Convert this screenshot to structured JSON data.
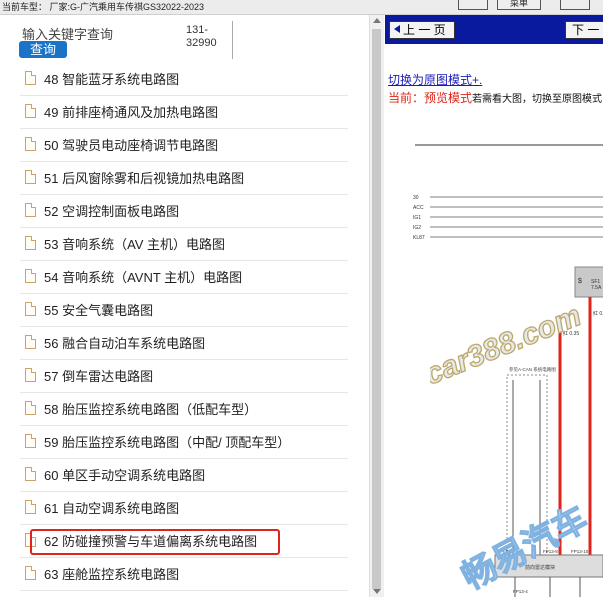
{
  "topbar": {
    "model_text": "当前车型： 厂家:G-广汽乘用车传祺GS32022-2023",
    "button_label": "菜单"
  },
  "search": {
    "label": "输入关键字查询",
    "button": "查询",
    "code_line1": "131-",
    "code_line2": "32990"
  },
  "list": [
    {
      "label": "48 智能蓝牙系统电路图"
    },
    {
      "label": "49 前排座椅通风及加热电路图"
    },
    {
      "label": "50 驾驶员电动座椅调节电路图"
    },
    {
      "label": "51 后风窗除雾和后视镜加热电路图"
    },
    {
      "label": "52 空调控制面板电路图"
    },
    {
      "label": "53 音响系统（AV 主机）电路图"
    },
    {
      "label": "54 音响系统（AVNT 主机）电路图"
    },
    {
      "label": "55 安全气囊电路图"
    },
    {
      "label": "56 融合自动泊车系统电路图"
    },
    {
      "label": "57 倒车雷达电路图"
    },
    {
      "label": "58 胎压监控系统电路图（低配车型）"
    },
    {
      "label": "59 胎压监控系统电路图（中配/ 顶配车型）"
    },
    {
      "label": "60 单区手动空调系统电路图"
    },
    {
      "label": "61 自动空调系统电路图"
    },
    {
      "label": "62 防碰撞预警与车道偏离系统电路图"
    },
    {
      "label": "63 座舱监控系统电路图"
    }
  ],
  "viewer": {
    "prev_label": "上 一 页",
    "next_label": "下 一",
    "switch_link": "切换为原图模式+.",
    "preview_prefix": "当前：",
    "preview_mode": "预览模式",
    "preview_suffix": "若需看大图，切换至原图模式",
    "rails": [
      "30",
      "ACC",
      "IG1",
      "IG2",
      "KL87"
    ],
    "fuse_label": "SF1",
    "fuse_value": "7.5A",
    "wire_label": "红  0.35",
    "module_caption": "参见A-CAN 系统电路图",
    "module_name": "前向雷达模块",
    "pins": [
      "FP13-3",
      "FP13-4",
      "FP13-8",
      "FP13-10"
    ],
    "watermark1": "car388.com",
    "watermark2": "畅易汽车"
  },
  "colors": {
    "accent_blue": "#1a73c7",
    "nav_blue": "#0a1a9e",
    "highlight_red": "#e0241b",
    "wire_red": "#e0241b"
  }
}
